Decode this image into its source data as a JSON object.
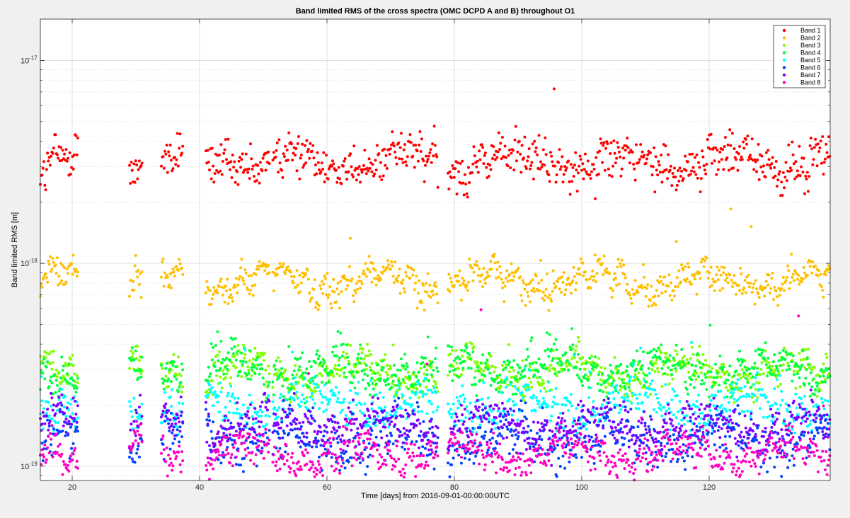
{
  "chart_data": {
    "type": "scatter",
    "title": "Band limited RMS of the cross spectra (OMC DCPD A and B) throughout O1",
    "xlabel": "Time [days] from 2016-09-01-00:00:00UTC",
    "ylabel": "Band limited RMS [m]",
    "xlim": [
      15,
      139
    ],
    "ylim": [
      8.5e-20,
      1.6e-17
    ],
    "yscale": "log",
    "grid": true,
    "legend_position": "top-right",
    "x_ticks": [
      20,
      40,
      60,
      80,
      100,
      120
    ],
    "x_tick_labels": [
      "20",
      "40",
      "60",
      "80",
      "100",
      "120"
    ],
    "y_ticks": [
      1e-19,
      1e-18,
      1e-17
    ],
    "y_tick_labels": [
      {
        "base": "10",
        "exp": "-19"
      },
      {
        "base": "10",
        "exp": "-18"
      },
      {
        "base": "10",
        "exp": "-17"
      }
    ],
    "segments": [
      [
        15,
        21
      ],
      [
        29,
        31
      ],
      [
        34,
        37.5
      ],
      [
        41,
        51
      ],
      [
        51.5,
        77.5
      ],
      [
        79,
        139
      ]
    ],
    "series": [
      {
        "name": "Band 1",
        "color": "#ff0000",
        "typical": 3.2e-18,
        "spread": 0.11,
        "spike_max": 9.5e-18
      },
      {
        "name": "Band 2",
        "color": "#ffbf00",
        "typical": 8.2e-19,
        "spread": 0.07,
        "spike_max": 2e-18
      },
      {
        "name": "Band 3",
        "color": "#80ff00",
        "typical": 2.9e-19,
        "spread": 0.08,
        "spike_max": 4e-19
      },
      {
        "name": "Band 4",
        "color": "#00ff40",
        "typical": 3e-19,
        "spread": 0.09,
        "spike_max": 5e-19
      },
      {
        "name": "Band 5",
        "color": "#00ffff",
        "typical": 2e-19,
        "spread": 0.09,
        "spike_max": 6e-19
      },
      {
        "name": "Band 6",
        "color": "#0040ff",
        "typical": 1.35e-19,
        "spread": 0.11,
        "spike_max": 2e-19
      },
      {
        "name": "Band 7",
        "color": "#8000ff",
        "typical": 1.6e-19,
        "spread": 0.09,
        "spike_max": 3e-19
      },
      {
        "name": "Band 8",
        "color": "#ff00bf",
        "typical": 1.15e-19,
        "spread": 0.08,
        "spike_max": 6e-19
      }
    ]
  }
}
